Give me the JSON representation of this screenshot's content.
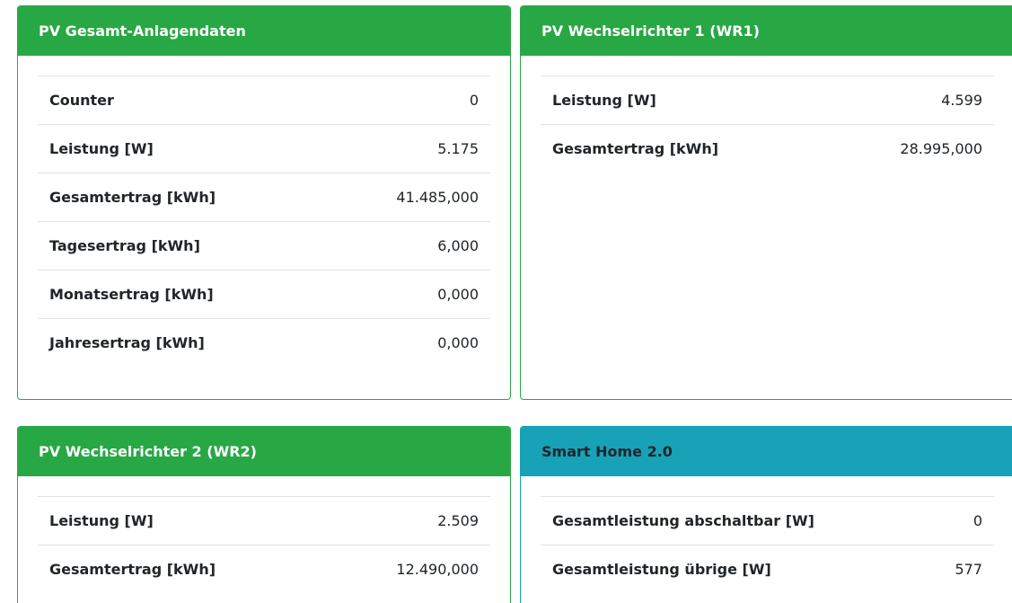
{
  "cards": {
    "gesamt": {
      "title": "PV Gesamt-Anlagendaten",
      "rows": [
        {
          "label": "Counter",
          "value": "0"
        },
        {
          "label": "Leistung [W]",
          "value": "5.175"
        },
        {
          "label": "Gesamtertrag [kWh]",
          "value": "41.485,000"
        },
        {
          "label": "Tagesertrag [kWh]",
          "value": "6,000"
        },
        {
          "label": "Monatsertrag [kWh]",
          "value": "0,000"
        },
        {
          "label": "Jahresertrag [kWh]",
          "value": "0,000"
        }
      ]
    },
    "wr1": {
      "title": "PV Wechselrichter 1 (WR1)",
      "rows": [
        {
          "label": "Leistung [W]",
          "value": "4.599"
        },
        {
          "label": "Gesamtertrag [kWh]",
          "value": "28.995,000"
        }
      ]
    },
    "wr2": {
      "title": "PV Wechselrichter 2 (WR2)",
      "rows": [
        {
          "label": "Leistung [W]",
          "value": "2.509"
        },
        {
          "label": "Gesamtertrag [kWh]",
          "value": "12.490,000"
        }
      ]
    },
    "smarthome": {
      "title": "Smart Home 2.0",
      "rows": [
        {
          "label": "Gesamtleistung abschaltbar [W]",
          "value": "0"
        },
        {
          "label": "Gesamtleistung übrige [W]",
          "value": "577"
        }
      ]
    }
  },
  "colors": {
    "success": "#28a745",
    "info": "#17a2b8",
    "border": "#dee2e6"
  }
}
